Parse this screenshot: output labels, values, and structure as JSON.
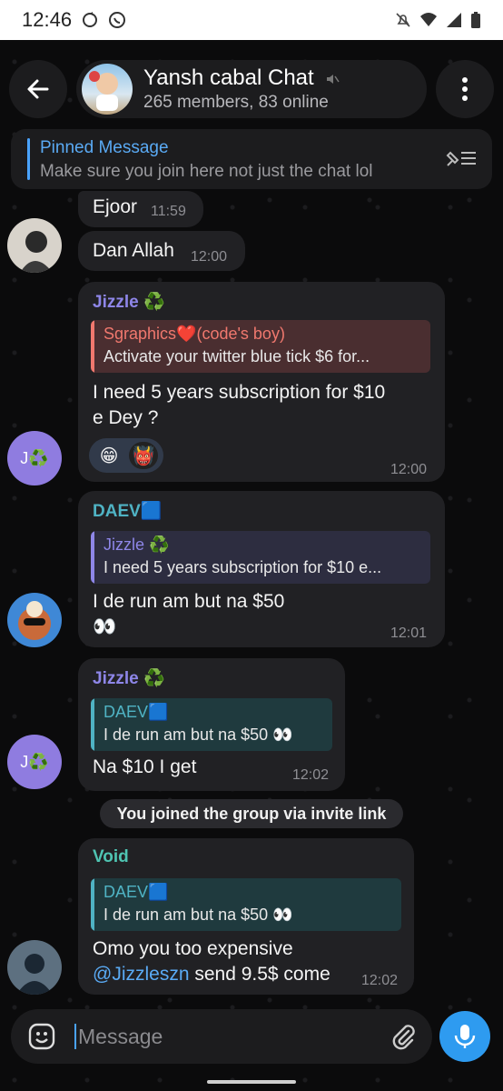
{
  "status_bar": {
    "time": "12:46"
  },
  "header": {
    "title": "Yansh cabal Chat",
    "subtitle": "265 members, 83 online"
  },
  "pinned": {
    "label": "Pinned Message",
    "text": "Make sure you join here not just the chat lol"
  },
  "messages": [
    {
      "text": "Ejoor",
      "time": "11:59"
    },
    {
      "text": "Dan Allah",
      "time": "12:00"
    },
    {
      "sender": "Jizzle ♻️",
      "reply_name": "Sgraphics❤️(code's boy)",
      "reply_text": "Activate your twitter blue tick   $6 for...",
      "text_line1": "I need 5 years subscription for $10",
      "text_line2": "e Dey ?",
      "reactions": [
        "😁",
        "👹"
      ],
      "time": "12:00"
    },
    {
      "sender": "DAEV🟦",
      "reply_name": "Jizzle ♻️",
      "reply_text": "I need 5 years subscription for $10 e...",
      "text_line1": "I de run am but na $50",
      "text_line2": "👀",
      "time": "12:01"
    },
    {
      "sender": "Jizzle ♻️",
      "reply_name": "DAEV🟦",
      "reply_text": "I de run am but na $50 👀",
      "text_line1": "Na $10 I get",
      "time": "12:02"
    },
    {
      "sender": "Void",
      "reply_name": "DAEV🟦",
      "reply_text": "I de run am but na $50 👀",
      "text_line1": "Omo you too expensive",
      "mention": "@Jizzleszn",
      "text_line2": " send 9.5$ come",
      "time": "12:02"
    }
  ],
  "service_message": "You joined the group via invite link",
  "avatars": {
    "jizzle_initial": "J♻️"
  },
  "input": {
    "placeholder": "Message"
  },
  "colors": {
    "accent": "#2e9bf0",
    "jizzle": "#8e86e8",
    "daev": "#4fb3c4",
    "void": "#4fc4b2",
    "sgraphics": "#f0786e"
  }
}
